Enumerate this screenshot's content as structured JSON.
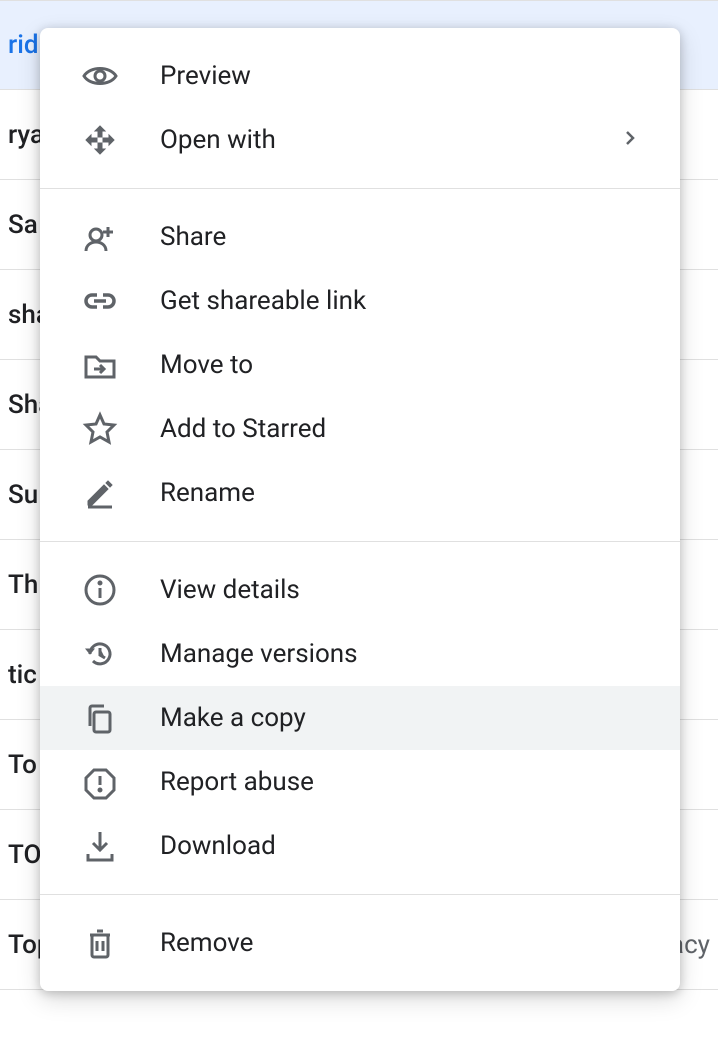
{
  "background_rows": [
    {
      "text_left": "rid",
      "selected": true
    },
    {
      "text_left": "rya"
    },
    {
      "text_left": "Sa"
    },
    {
      "text_left": "sha"
    },
    {
      "text_left": "Sha"
    },
    {
      "text_left": "Su"
    },
    {
      "text_left": "Th"
    },
    {
      "text_left": "tic"
    },
    {
      "text_left": "To"
    },
    {
      "text_left": "TO"
    },
    {
      "text_left": "Top",
      "text_right": "vacy"
    }
  ],
  "menu": {
    "groups": [
      [
        {
          "icon": "preview",
          "label": "Preview",
          "name": "menu-preview"
        },
        {
          "icon": "openwith",
          "label": "Open with",
          "submenu": true,
          "name": "menu-open-with"
        }
      ],
      [
        {
          "icon": "share",
          "label": "Share",
          "name": "menu-share"
        },
        {
          "icon": "link",
          "label": "Get shareable link",
          "name": "menu-get-link"
        },
        {
          "icon": "moveto",
          "label": "Move to",
          "name": "menu-move-to"
        },
        {
          "icon": "star",
          "label": "Add to Starred",
          "name": "menu-add-starred"
        },
        {
          "icon": "rename",
          "label": "Rename",
          "name": "menu-rename"
        }
      ],
      [
        {
          "icon": "details",
          "label": "View details",
          "name": "menu-view-details"
        },
        {
          "icon": "versions",
          "label": "Manage versions",
          "name": "menu-manage-versions"
        },
        {
          "icon": "copy",
          "label": "Make a copy",
          "hover": true,
          "name": "menu-make-copy"
        },
        {
          "icon": "report",
          "label": "Report abuse",
          "name": "menu-report-abuse"
        },
        {
          "icon": "download",
          "label": "Download",
          "name": "menu-download"
        }
      ],
      [
        {
          "icon": "remove",
          "label": "Remove",
          "name": "menu-remove"
        }
      ]
    ]
  }
}
